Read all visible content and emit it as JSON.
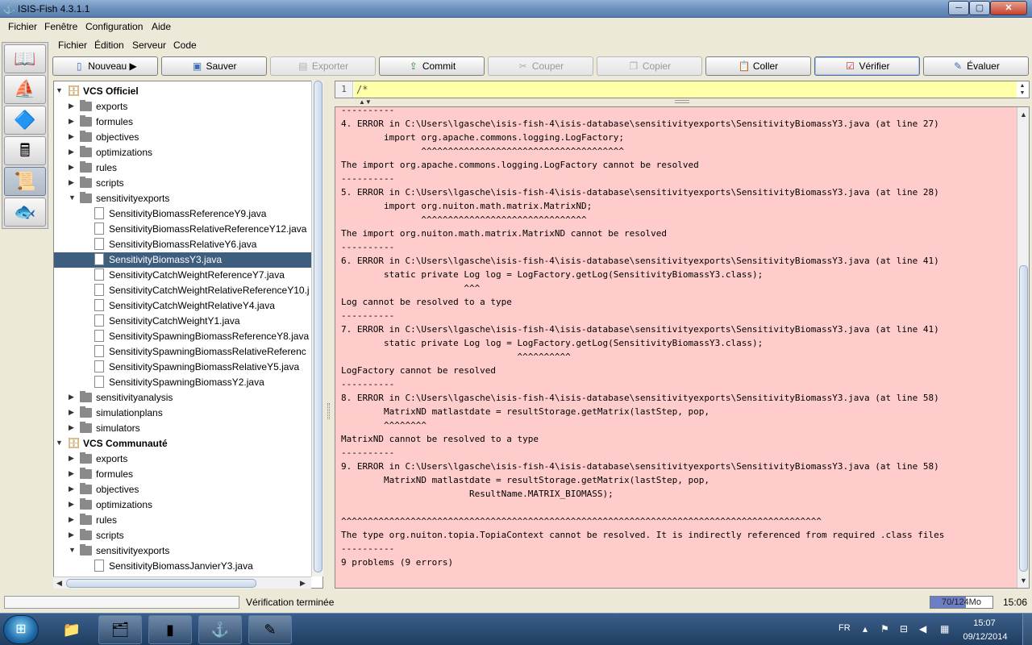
{
  "window": {
    "title": "ISIS-Fish 4.3.1.1",
    "min_glyph": "─",
    "max_glyph": "▢",
    "close_glyph": "✕"
  },
  "menubar": [
    "Fichier",
    "Fenêtre",
    "Configuration",
    "Aide"
  ],
  "launcher": [
    "book-icon",
    "fishing-boat-icon",
    "fish-ladder-icon",
    "calculator-icon",
    "script-editor-icon",
    "red-fish-icon"
  ],
  "editor_frame": {
    "menubar": [
      "Fichier",
      "Édition",
      "Serveur",
      "Code"
    ],
    "toolbar": {
      "nouveau": "Nouveau ▶",
      "sauver": "Sauver",
      "exporter": "Exporter",
      "commit": "Commit",
      "couper": "Couper",
      "copier": "Copier",
      "coller": "Coller",
      "verifier": "Vérifier",
      "evaluer": "Évaluer"
    }
  },
  "tree": {
    "rows": [
      {
        "label": "VCS Officiel",
        "level": 0,
        "kind": "root",
        "expanded": true
      },
      {
        "label": "exports",
        "level": 1,
        "kind": "folder",
        "expanded": false
      },
      {
        "label": "formules",
        "level": 1,
        "kind": "folder",
        "expanded": false
      },
      {
        "label": "objectives",
        "level": 1,
        "kind": "folder",
        "expanded": false
      },
      {
        "label": "optimizations",
        "level": 1,
        "kind": "folder",
        "expanded": false
      },
      {
        "label": "rules",
        "level": 1,
        "kind": "folder",
        "expanded": false
      },
      {
        "label": "scripts",
        "level": 1,
        "kind": "folder",
        "expanded": false
      },
      {
        "label": "sensitivityexports",
        "level": 1,
        "kind": "folder",
        "expanded": true
      },
      {
        "label": "SensitivityBiomassReferenceY9.java",
        "level": 2,
        "kind": "file"
      },
      {
        "label": "SensitivityBiomassRelativeReferenceY12.java",
        "level": 2,
        "kind": "file"
      },
      {
        "label": "SensitivityBiomassRelativeY6.java",
        "level": 2,
        "kind": "file"
      },
      {
        "label": "SensitivityBiomassY3.java",
        "level": 2,
        "kind": "file",
        "selected": true
      },
      {
        "label": "SensitivityCatchWeightReferenceY7.java",
        "level": 2,
        "kind": "file"
      },
      {
        "label": "SensitivityCatchWeightRelativeReferenceY10.j",
        "level": 2,
        "kind": "file"
      },
      {
        "label": "SensitivityCatchWeightRelativeY4.java",
        "level": 2,
        "kind": "file"
      },
      {
        "label": "SensitivityCatchWeightY1.java",
        "level": 2,
        "kind": "file"
      },
      {
        "label": "SensitivitySpawningBiomassReferenceY8.java",
        "level": 2,
        "kind": "file"
      },
      {
        "label": "SensitivitySpawningBiomassRelativeReferenc",
        "level": 2,
        "kind": "file"
      },
      {
        "label": "SensitivitySpawningBiomassRelativeY5.java",
        "level": 2,
        "kind": "file"
      },
      {
        "label": "SensitivitySpawningBiomassY2.java",
        "level": 2,
        "kind": "file"
      },
      {
        "label": "sensitivityanalysis",
        "level": 1,
        "kind": "folder",
        "expanded": false
      },
      {
        "label": "simulationplans",
        "level": 1,
        "kind": "folder",
        "expanded": false
      },
      {
        "label": "simulators",
        "level": 1,
        "kind": "folder",
        "expanded": false
      },
      {
        "label": "VCS Communauté",
        "level": 0,
        "kind": "root",
        "expanded": true
      },
      {
        "label": "exports",
        "level": 1,
        "kind": "folder",
        "expanded": false
      },
      {
        "label": "formules",
        "level": 1,
        "kind": "folder",
        "expanded": false
      },
      {
        "label": "objectives",
        "level": 1,
        "kind": "folder",
        "expanded": false
      },
      {
        "label": "optimizations",
        "level": 1,
        "kind": "folder",
        "expanded": false
      },
      {
        "label": "rules",
        "level": 1,
        "kind": "folder",
        "expanded": false
      },
      {
        "label": "scripts",
        "level": 1,
        "kind": "folder",
        "expanded": false
      },
      {
        "label": "sensitivityexports",
        "level": 1,
        "kind": "folder",
        "expanded": true
      },
      {
        "label": "SensitivityBiomassJanvierY3.java",
        "level": 2,
        "kind": "file"
      }
    ]
  },
  "editor": {
    "line_number": "1",
    "line_text": "/*"
  },
  "output": {
    "text": "----------\n4. ERROR in C:\\Users\\lgasche\\isis-fish-4\\isis-database\\sensitivityexports\\SensitivityBiomassY3.java (at line 27)\n\timport org.apache.commons.logging.LogFactory;\n\t       ^^^^^^^^^^^^^^^^^^^^^^^^^^^^^^^^^^^^^^\nThe import org.apache.commons.logging.LogFactory cannot be resolved\n----------\n5. ERROR in C:\\Users\\lgasche\\isis-fish-4\\isis-database\\sensitivityexports\\SensitivityBiomassY3.java (at line 28)\n\timport org.nuiton.math.matrix.MatrixND;\n\t       ^^^^^^^^^^^^^^^^^^^^^^^^^^^^^^^\nThe import org.nuiton.math.matrix.MatrixND cannot be resolved\n----------\n6. ERROR in C:\\Users\\lgasche\\isis-fish-4\\isis-database\\sensitivityexports\\SensitivityBiomassY3.java (at line 41)\n\tstatic private Log log = LogFactory.getLog(SensitivityBiomassY3.class);\n\t               ^^^\nLog cannot be resolved to a type\n----------\n7. ERROR in C:\\Users\\lgasche\\isis-fish-4\\isis-database\\sensitivityexports\\SensitivityBiomassY3.java (at line 41)\n\tstatic private Log log = LogFactory.getLog(SensitivityBiomassY3.class);\n\t                         ^^^^^^^^^^\nLogFactory cannot be resolved\n----------\n8. ERROR in C:\\Users\\lgasche\\isis-fish-4\\isis-database\\sensitivityexports\\SensitivityBiomassY3.java (at line 58)\n\tMatrixND matlastdate = resultStorage.getMatrix(lastStep, pop,\n\t^^^^^^^^\nMatrixND cannot be resolved to a type\n----------\n9. ERROR in C:\\Users\\lgasche\\isis-fish-4\\isis-database\\sensitivityexports\\SensitivityBiomassY3.java (at line 58)\n\tMatrixND matlastdate = resultStorage.getMatrix(lastStep, pop,\n\t                ResultName.MATRIX_BIOMASS);\n\n^^^^^^^^^^^^^^^^^^^^^^^^^^^^^^^^^^^^^^^^^^^^^^^^^^^^^^^^^^^^^^^^^^^^^^^^^^^^^^^^^^^^^^^^^^\nThe type org.nuiton.topia.TopiaContext cannot be resolved. It is indirectly referenced from required .class files\n----------\n9 problems (9 errors)"
  },
  "statusbar": {
    "message": "Vérification terminée",
    "memory": "70/124Mo",
    "memory_used_fraction": 0.565,
    "clock": "15:06"
  },
  "taskbar": {
    "apps": [
      "folder-notes-icon",
      "file-explorer-icon",
      "command-prompt-icon",
      "isis-fish-icon",
      "notepad-plus-plus-icon"
    ],
    "language": "FR",
    "time": "15:07",
    "date": "09/12/2014"
  }
}
